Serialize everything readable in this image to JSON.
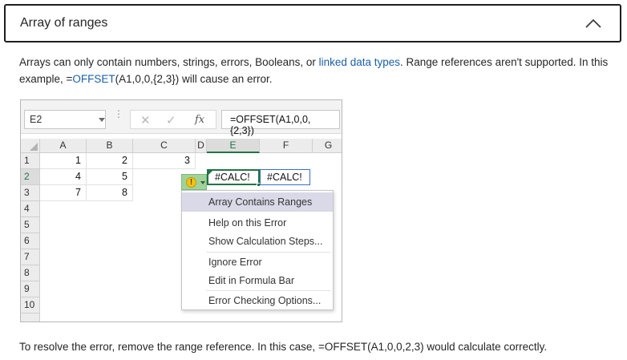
{
  "accordion": {
    "title": "Array of ranges"
  },
  "intro": {
    "t1": "Arrays can only contain numbers, strings, errors, Booleans, or ",
    "link": "linked data types",
    "t2": ". Range references aren't supported. In this example, =",
    "fn": "OFFSET",
    "t3": "(A1,0,0,{2,3}) will cause an error."
  },
  "excel": {
    "name_box": "E2",
    "fx_label": "fx",
    "formula": "=OFFSET(A1,0,0,{2,3})",
    "columns": [
      "A",
      "B",
      "C",
      "D",
      "E",
      "F",
      "G"
    ],
    "rows": [
      "1",
      "2",
      "3",
      "4",
      "5",
      "6",
      "7",
      "8",
      "9",
      "10"
    ],
    "cells": {
      "A1": "1",
      "B1": "2",
      "C1": "3",
      "A2": "4",
      "B2": "5",
      "E2": "#CALC!",
      "F2": "#CALC!",
      "A3": "7",
      "B3": "8"
    },
    "error_icon": "!",
    "context_menu": {
      "title": "Array Contains Ranges",
      "items": [
        "Help on this Error",
        "Show Calculation Steps...",
        "Ignore Error",
        "Edit in Formula Bar",
        "Error Checking Options..."
      ]
    }
  },
  "resolution": "To resolve the error, remove the range reference. In this case, =OFFSET(A1,0,0,2,3) would calculate correctly.",
  "colors": {
    "link": "#1a5fa8",
    "excel_green": "#217346",
    "error_button": "#9fd39a",
    "menu_highlight": "#d9d9e8"
  },
  "icons": {
    "collapse": "chevron-up-icon",
    "error": "warning-icon",
    "cancel": "x-icon",
    "enter": "check-icon",
    "function": "fx-icon"
  }
}
